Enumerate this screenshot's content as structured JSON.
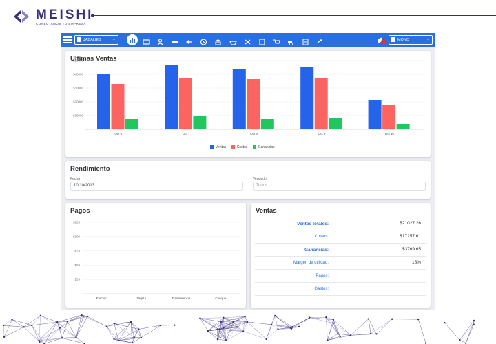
{
  "brand": {
    "name": "MEISHI",
    "tagline": "CONECTAMOS TU EMPRESA"
  },
  "topbar": {
    "store_select": "JABALIES",
    "user_select": "MONO",
    "nav_icons": [
      "home-chart-icon",
      "register-icon",
      "user-icon",
      "truck-icon",
      "return-icon",
      "clock-icon",
      "bank-icon",
      "basket-icon",
      "tools-icon",
      "clipboard-icon",
      "cart-icon",
      "delivery-icon",
      "list-icon",
      "transfer-icon"
    ],
    "accent_color": "#2a6fe0"
  },
  "ultimas_ventas": {
    "title": "Ultimas Ventas",
    "legend": [
      "Ventas",
      "Costos",
      "Ganancias"
    ]
  },
  "rendimiento": {
    "title": "Rendimiento",
    "fecha_label": "Fecha",
    "fecha_value": "10/10/2013",
    "vendedor_label": "Vendedor",
    "vendedor_placeholder": "Todos"
  },
  "pagos": {
    "title": "Pagos"
  },
  "ventas_summary": {
    "title": "Ventas",
    "rows": [
      {
        "label": "Ventas totales:",
        "value": "$21027.26"
      },
      {
        "label": "Costos:",
        "value": "$17257.61"
      },
      {
        "label": "Ganancias:",
        "value": "$3769.65"
      },
      {
        "label": "Margen de utilidad:",
        "value": "18%"
      },
      {
        "label": "Pagos:",
        "value": ""
      },
      {
        "label": "Gastos:",
        "value": ""
      }
    ]
  },
  "chart_data": [
    {
      "type": "bar",
      "title": "Ultimas Ventas",
      "categories": [
        "Oct 6",
        "Oct 7",
        "Oct 8",
        "Oct 9",
        "Oct 10"
      ],
      "series": [
        {
          "name": "Ventas",
          "color": "#2563eb",
          "values": [
            40500,
            46500,
            44000,
            45500,
            21000
          ]
        },
        {
          "name": "Costos",
          "color": "#fb6461",
          "values": [
            33000,
            37000,
            36500,
            37500,
            17500
          ]
        },
        {
          "name": "Ganancias",
          "color": "#22c55e",
          "values": [
            7500,
            9500,
            7500,
            8500,
            4000
          ]
        }
      ],
      "yticks": [
        "$10000",
        "$20000",
        "$30000",
        "$40000",
        "$50000"
      ],
      "ylim": [
        0,
        50000
      ],
      "legend_position": "bottom"
    },
    {
      "type": "bar",
      "title": "Pagos",
      "categories": [
        "Efectivo",
        "Tarjeta",
        "Transferencia",
        "Cheque"
      ],
      "series": [
        {
          "values": [
            0,
            0,
            0,
            0
          ]
        }
      ],
      "yticks": [
        "$25",
        "$50",
        "$75",
        "$100",
        "$125"
      ],
      "ylim": [
        0,
        125
      ]
    }
  ]
}
